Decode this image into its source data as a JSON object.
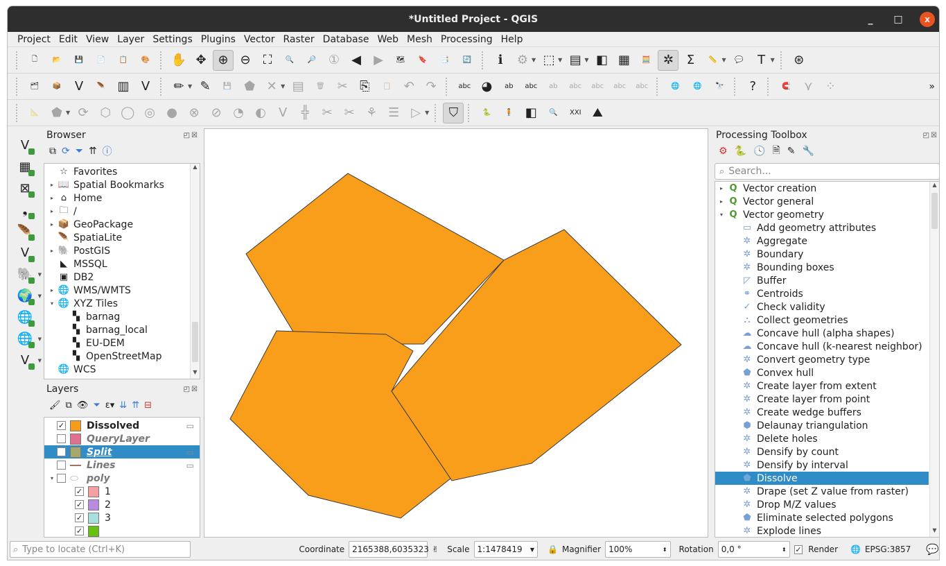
{
  "window": {
    "title": "*Untitled Project - QGIS",
    "controls": [
      "_",
      "□",
      "x"
    ]
  },
  "menu": [
    "Project",
    "Edit",
    "View",
    "Layer",
    "Settings",
    "Plugins",
    "Vector",
    "Raster",
    "Database",
    "Web",
    "Mesh",
    "Processing",
    "Help"
  ],
  "toolbar1": [
    {
      "name": "new-project-icon",
      "glyph": "🗋"
    },
    {
      "name": "open-project-icon",
      "glyph": "📂"
    },
    {
      "name": "save-project-icon",
      "glyph": "💾"
    },
    {
      "name": "new-print-layout-icon",
      "glyph": "📄"
    },
    {
      "name": "layout-manager-icon",
      "glyph": "📋"
    },
    {
      "name": "style-manager-icon",
      "glyph": "🎨"
    },
    {
      "grip": true
    },
    {
      "name": "pan-icon",
      "glyph": "✋"
    },
    {
      "name": "pan-to-selection-icon",
      "glyph": "✥"
    },
    {
      "name": "zoom-in-icon",
      "glyph": "⊕",
      "on": true
    },
    {
      "name": "zoom-out-icon",
      "glyph": "⊖"
    },
    {
      "name": "zoom-full-icon",
      "glyph": "⛶"
    },
    {
      "name": "zoom-to-selection-icon",
      "glyph": "🔍"
    },
    {
      "name": "zoom-to-layer-icon",
      "glyph": "🔎"
    },
    {
      "name": "zoom-native-icon",
      "glyph": "①",
      "dim": true
    },
    {
      "name": "zoom-last-icon",
      "glyph": "◀"
    },
    {
      "name": "zoom-next-icon",
      "glyph": "▶",
      "dim": true
    },
    {
      "name": "new-map-view-icon",
      "glyph": "🗺"
    },
    {
      "name": "new-bookmark-icon",
      "glyph": "🔖"
    },
    {
      "name": "show-bookmarks-icon",
      "glyph": "📑"
    },
    {
      "name": "refresh-icon",
      "glyph": "🔄"
    },
    {
      "grip": true
    },
    {
      "name": "identify-icon",
      "glyph": "ℹ"
    },
    {
      "name": "run-action-icon",
      "glyph": "⚙",
      "dim": true,
      "dd": true
    },
    {
      "name": "select-features-icon",
      "glyph": "⬚",
      "dd": true
    },
    {
      "name": "select-by-value-icon",
      "glyph": "▤",
      "dd": true
    },
    {
      "name": "deselect-icon",
      "glyph": "◧"
    },
    {
      "name": "attribute-table-icon",
      "glyph": "▦"
    },
    {
      "name": "field-calculator-icon",
      "glyph": "🧮"
    },
    {
      "name": "processing-toolbox-icon",
      "glyph": "✲",
      "on": true
    },
    {
      "name": "statistical-summary-icon",
      "glyph": "Σ"
    },
    {
      "name": "measure-icon",
      "glyph": "📏",
      "dd": true
    },
    {
      "name": "map-tips-icon",
      "glyph": "💬"
    },
    {
      "name": "text-annotation-icon",
      "glyph": "T",
      "dd": true
    },
    {
      "grip": true
    },
    {
      "name": "plugin-stamp-icon",
      "glyph": "⊛"
    }
  ],
  "toolbar2": [
    {
      "name": "data-source-manager-icon",
      "glyph": "🗂"
    },
    {
      "name": "new-geopackage-icon",
      "glyph": "📦"
    },
    {
      "name": "new-shapefile-icon",
      "glyph": "V"
    },
    {
      "name": "new-spatialite-icon",
      "glyph": "🪶"
    },
    {
      "name": "new-temp-layer-icon",
      "glyph": "▥"
    },
    {
      "name": "new-virtual-layer-icon",
      "glyph": "V"
    },
    {
      "grip": true
    },
    {
      "name": "current-edits-icon",
      "glyph": "✏",
      "dd": true
    },
    {
      "name": "toggle-editing-icon",
      "glyph": "✎"
    },
    {
      "name": "save-edits-icon",
      "glyph": "💾",
      "dim": true
    },
    {
      "name": "add-polygon-icon",
      "glyph": "⬟",
      "dim": true
    },
    {
      "name": "vertex-tool-icon",
      "glyph": "✕",
      "dim": true,
      "dd": true
    },
    {
      "name": "modify-attributes-icon",
      "glyph": "▤",
      "dim": true
    },
    {
      "name": "delete-selected-icon",
      "glyph": "🗑",
      "dim": true
    },
    {
      "name": "cut-features-icon",
      "glyph": "✂",
      "dim": true
    },
    {
      "name": "copy-features-icon",
      "glyph": "⎘"
    },
    {
      "name": "paste-features-icon",
      "glyph": "📋",
      "dim": true
    },
    {
      "name": "undo-icon",
      "glyph": "↶",
      "dim": true
    },
    {
      "name": "redo-icon",
      "glyph": "↷",
      "dim": true
    },
    {
      "grip": true
    },
    {
      "name": "layer-labeling-icon",
      "glyph": "abc"
    },
    {
      "name": "layer-diagram-icon",
      "glyph": "◕"
    },
    {
      "name": "pin-labels-icon",
      "glyph": "ab"
    },
    {
      "name": "highlight-pinned-labels-icon",
      "glyph": "abc"
    },
    {
      "name": "move-label-icon",
      "glyph": "ab",
      "dim": true
    },
    {
      "name": "show-hide-labels-icon",
      "glyph": "abc",
      "dim": true
    },
    {
      "name": "move-label2-icon",
      "glyph": "abc",
      "dim": true
    },
    {
      "name": "rotate-label-icon",
      "glyph": "abc",
      "dim": true
    },
    {
      "name": "change-label-icon",
      "glyph": "abc",
      "dim": true
    },
    {
      "grip": true
    },
    {
      "name": "add-wms-layer-icon",
      "glyph": "🌐"
    },
    {
      "name": "search-wms-icon",
      "glyph": "🌐"
    },
    {
      "name": "metasearch-icon",
      "glyph": "🔭"
    },
    {
      "grip": true
    },
    {
      "name": "help-icon",
      "glyph": "?"
    },
    {
      "grip": true
    },
    {
      "name": "snapping-icon",
      "glyph": "🧲"
    },
    {
      "name": "topology-icon",
      "glyph": "⋎",
      "dim": true
    },
    {
      "name": "tracing-icon",
      "glyph": "⁘",
      "dim": true
    }
  ],
  "toolbar2_more": "»",
  "toolbar3": [
    {
      "name": "advanced-digitizing-icon",
      "glyph": "📐",
      "dim": true
    },
    {
      "name": "move-feature-icon",
      "glyph": "⬟",
      "dim": true,
      "dd": true
    },
    {
      "name": "rotate-feature-icon",
      "glyph": "⟳",
      "dim": true
    },
    {
      "name": "simplify-icon",
      "glyph": "⬡",
      "dim": true
    },
    {
      "name": "add-ring-icon",
      "glyph": "◯",
      "dim": true
    },
    {
      "name": "add-part-icon",
      "glyph": "◎",
      "dim": true
    },
    {
      "name": "fill-ring-icon",
      "glyph": "●",
      "dim": true
    },
    {
      "name": "delete-ring-icon",
      "glyph": "⊗",
      "dim": true
    },
    {
      "name": "delete-part-icon",
      "glyph": "⊘",
      "dim": true
    },
    {
      "name": "reshape-icon",
      "glyph": "◔",
      "dim": true
    },
    {
      "name": "offset-curve-icon",
      "glyph": "◐",
      "dim": true
    },
    {
      "name": "reverse-line-icon",
      "glyph": "V",
      "dim": true
    },
    {
      "name": "split-features-icon",
      "glyph": "╬",
      "dim": true
    },
    {
      "name": "split-parts-icon",
      "glyph": "✂",
      "dim": true
    },
    {
      "name": "merge-features-icon",
      "glyph": "✂",
      "dim": true
    },
    {
      "name": "merge-attributes-icon",
      "glyph": "⚘",
      "dim": true
    },
    {
      "name": "rotate-point-symbols-icon",
      "glyph": "☰",
      "dim": true
    },
    {
      "name": "offset-point-symbols-icon",
      "glyph": "▷",
      "dim": true,
      "dd": true
    },
    {
      "grip": true
    },
    {
      "name": "shape-digitize-icon",
      "glyph": "⛉",
      "on": true
    },
    {
      "grip": true
    },
    {
      "name": "python-console-icon",
      "glyph": "🐍"
    },
    {
      "name": "person-plugin-icon",
      "glyph": "🧍"
    },
    {
      "name": "map-swipe-icon",
      "glyph": "◧"
    },
    {
      "name": "search-layers-icon",
      "glyph": "🔍"
    },
    {
      "name": "roman-numeral-plugin-icon",
      "glyph": "XXI"
    },
    {
      "name": "terrain-plugin-icon",
      "glyph": "⛰"
    }
  ],
  "leftbar": [
    {
      "name": "add-vector-layer-icon",
      "glyph": "V"
    },
    {
      "name": "add-raster-layer-icon",
      "glyph": "▦"
    },
    {
      "name": "add-mesh-layer-icon",
      "glyph": "⊠"
    },
    {
      "name": "add-delimited-text-icon",
      "glyph": "❟"
    },
    {
      "name": "add-spatialite-layer-icon",
      "glyph": "🪶"
    },
    {
      "name": "add-virtual-layer-icon",
      "glyph": "V"
    },
    {
      "name": "add-postgis-layer-icon",
      "glyph": "🐘",
      "dd": true
    },
    {
      "name": "add-wms-layer-icon",
      "glyph": "🌍",
      "dd": true
    },
    {
      "name": "add-wcs-layer-icon",
      "glyph": "🌐"
    },
    {
      "name": "add-wfs-layer-icon",
      "glyph": "🌐",
      "dd": true
    },
    {
      "name": "new-shapefile-layer-icon",
      "glyph": "V",
      "dd": true
    }
  ],
  "browser": {
    "title": "Browser",
    "items": [
      {
        "label": "Favorites",
        "icon": "☆",
        "arrow": ""
      },
      {
        "label": "Spatial Bookmarks",
        "icon": "📖",
        "arrow": "▸"
      },
      {
        "label": "Home",
        "icon": "⌂",
        "arrow": "▸"
      },
      {
        "label": "/",
        "icon": "🗀",
        "arrow": "▸"
      },
      {
        "label": "GeoPackage",
        "icon": "📦",
        "arrow": "▸"
      },
      {
        "label": "SpatiaLite",
        "icon": "🪶",
        "arrow": ""
      },
      {
        "label": "PostGIS",
        "icon": "🐘",
        "arrow": "▸"
      },
      {
        "label": "MSSQL",
        "icon": "◣",
        "arrow": ""
      },
      {
        "label": "DB2",
        "icon": "▣",
        "arrow": ""
      },
      {
        "label": "WMS/WMTS",
        "icon": "🌐",
        "arrow": "▸"
      },
      {
        "label": "XYZ Tiles",
        "icon": "🌐",
        "arrow": "▾"
      },
      {
        "label": "barnag",
        "icon": "▚",
        "arrow": "",
        "indent": true
      },
      {
        "label": "barnag_local",
        "icon": "▚",
        "arrow": "",
        "indent": true
      },
      {
        "label": "EU-DEM",
        "icon": "▚",
        "arrow": "",
        "indent": true
      },
      {
        "label": "OpenStreetMap",
        "icon": "▚",
        "arrow": "",
        "indent": true
      },
      {
        "label": "WCS",
        "icon": "🌐",
        "arrow": ""
      }
    ]
  },
  "layers": {
    "title": "Layers",
    "items": [
      {
        "label": "Dissolved",
        "checked": true,
        "swatch": "#f59c1a",
        "style": "bold",
        "badge": true
      },
      {
        "label": "QueryLayer",
        "checked": false,
        "swatch": "#e07090",
        "style": "italic",
        "badge": false
      },
      {
        "label": "Split",
        "checked": false,
        "swatch": "#a4a86a",
        "style": "selected",
        "badge": true
      },
      {
        "label": "Lines",
        "checked": false,
        "swatch": "line",
        "style": "italic",
        "badge": true
      },
      {
        "label": "poly",
        "checked": false,
        "swatch": "group",
        "style": "italic",
        "badge": false,
        "arrow": "▾"
      },
      {
        "label": "1",
        "checked": true,
        "swatch": "#f4a0a0",
        "style": "child"
      },
      {
        "label": "2",
        "checked": true,
        "swatch": "#b88be0",
        "style": "child"
      },
      {
        "label": "3",
        "checked": true,
        "swatch": "#a8e0e0",
        "style": "child"
      },
      {
        "label": "",
        "checked": true,
        "swatch": "#66c010",
        "style": "child"
      }
    ]
  },
  "toolbox": {
    "title": "Processing Toolbox",
    "search_placeholder": "Search...",
    "groups": [
      {
        "label": "Vector creation",
        "arrow": "▸"
      },
      {
        "label": "Vector general",
        "arrow": "▸"
      },
      {
        "label": "Vector geometry",
        "arrow": "▾"
      }
    ],
    "algorithms": [
      {
        "label": "Add geometry attributes",
        "icon": "▭"
      },
      {
        "label": "Aggregate",
        "icon": "✲"
      },
      {
        "label": "Boundary",
        "icon": "✲"
      },
      {
        "label": "Bounding boxes",
        "icon": "✲"
      },
      {
        "label": "Buffer",
        "icon": "◸"
      },
      {
        "label": "Centroids",
        "icon": "⚭"
      },
      {
        "label": "Check validity",
        "icon": "✓"
      },
      {
        "label": "Collect geometries",
        "icon": "⛬"
      },
      {
        "label": "Concave hull (alpha shapes)",
        "icon": "☁"
      },
      {
        "label": "Concave hull (k-nearest neighbor)",
        "icon": "☁"
      },
      {
        "label": "Convert geometry type",
        "icon": "✲"
      },
      {
        "label": "Convex hull",
        "icon": "⬟"
      },
      {
        "label": "Create layer from extent",
        "icon": "✲"
      },
      {
        "label": "Create layer from point",
        "icon": "✲"
      },
      {
        "label": "Create wedge buffers",
        "icon": "✲"
      },
      {
        "label": "Delaunay triangulation",
        "icon": "⬢"
      },
      {
        "label": "Delete holes",
        "icon": "✲"
      },
      {
        "label": "Densify by count",
        "icon": "✲"
      },
      {
        "label": "Densify by interval",
        "icon": "✲"
      },
      {
        "label": "Dissolve",
        "icon": "⬟",
        "selected": true
      },
      {
        "label": "Drape (set Z value from raster)",
        "icon": "✲"
      },
      {
        "label": "Drop M/Z values",
        "icon": "✲"
      },
      {
        "label": "Eliminate selected polygons",
        "icon": "⬟"
      },
      {
        "label": "Explode lines",
        "icon": "✲"
      }
    ]
  },
  "map": {
    "fill_color": "#f99e1a",
    "stroke_color": "#3a3a3a"
  },
  "status": {
    "locate_placeholder": "Type to locate (Ctrl+K)",
    "coordinate_label": "Coordinate",
    "coordinate_value": "2165388,6035323",
    "scale_label": "Scale",
    "scale_value": "1:1478419",
    "magnifier_label": "Magnifier",
    "magnifier_value": "100%",
    "rotation_label": "Rotation",
    "rotation_value": "0,0 °",
    "render_label": "Render",
    "render_checked": true,
    "crs": "EPSG:3857"
  }
}
